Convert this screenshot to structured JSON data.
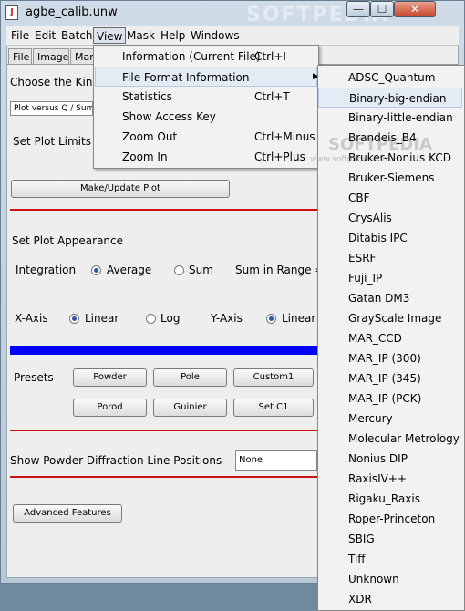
{
  "window": {
    "title": "agbe_calib.unw",
    "minimize": "—",
    "maximize": "☐",
    "close": "✕"
  },
  "menubar": [
    "File",
    "Edit",
    "Batch",
    "View",
    "Mask",
    "Help",
    "Windows"
  ],
  "tabs": [
    "File",
    "Image",
    "Man"
  ],
  "panel": {
    "choose_kind": "Choose the Kind",
    "plot_combo": "Plot versus Q / Sum",
    "set_limits": "Set Plot Limits",
    "make_update": "Make/Update Plot",
    "appearance": "Set Plot Appearance",
    "integration": "Integration",
    "average": "Average",
    "sum": "Sum",
    "sum_in_range": "Sum in Range =",
    "x_axis": "X-Axis",
    "linear": "Linear",
    "log": "Log",
    "y_axis": "Y-Axis",
    "y_linear": "Linear",
    "presets": "Presets",
    "powder": "Powder",
    "pole": "Pole",
    "custom1": "Custom1",
    "porod": "Porod",
    "guinier": "Guinier",
    "set_c1": "Set C1",
    "show_powder": "Show Powder Diffraction Line Positions",
    "powder_combo": "None",
    "advanced": "Advanced Features",
    "accent_blue": "#0000ff",
    "accent_red": "#cc1111"
  },
  "view_menu": [
    {
      "label": "Information (Current File)",
      "shortcut": "Ctrl+I"
    },
    {
      "label": "File Format Information",
      "shortcut": ""
    },
    {
      "label": "Statistics",
      "shortcut": "Ctrl+T"
    },
    {
      "label": "Show Access Key",
      "shortcut": ""
    },
    {
      "label": "Zoom Out",
      "shortcut": "Ctrl+Minus"
    },
    {
      "label": "Zoom In",
      "shortcut": "Ctrl+Plus"
    }
  ],
  "submenu": [
    "ADSC_Quantum",
    "Binary-big-endian",
    "Binary-little-endian",
    "Brandeis_B4",
    "Bruker-Nonius KCD",
    "Bruker-Siemens",
    "CBF",
    "CrysAlis",
    "Ditabis IPC",
    "ESRF",
    "Fuji_IP",
    "Gatan DM3",
    "GrayScale Image",
    "MAR_CCD",
    "MAR_IP (300)",
    "MAR_IP (345)",
    "MAR_IP (PCK)",
    "Mercury",
    "Molecular Metrology",
    "Nonius DIP",
    "RaxisIV++",
    "Rigaku_Raxis",
    "Roper-Princeton",
    "SBIG",
    "Tiff",
    "Unknown",
    "XDR"
  ],
  "watermark": "SOFTPEDIA",
  "watermark_url": "www.softpedia.com"
}
